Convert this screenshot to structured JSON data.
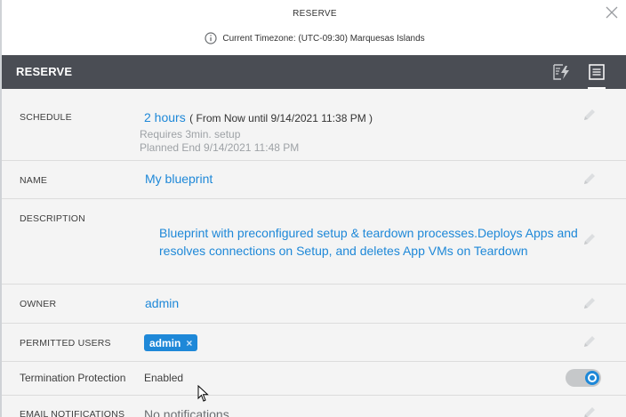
{
  "dialog": {
    "title": "RESERVE",
    "timezone_text": "Current Timezone: (UTC-09:30) Marquesas Islands"
  },
  "header_bar": {
    "title": "RESERVE",
    "icons": [
      "lightning-list-icon",
      "details-list-icon"
    ]
  },
  "schedule": {
    "label": "SCHEDULE",
    "duration": "2 hours",
    "range": "( From Now until 9/14/2021 11:38 PM )",
    "setup_note": "Requires 3min. setup",
    "planned_end": "Planned End 9/14/2021 11:48 PM"
  },
  "name": {
    "label": "NAME",
    "value": "My blueprint"
  },
  "description": {
    "label": "DESCRIPTION",
    "line1": "Blueprint with preconfigured setup & teardown processes.Deploys Apps and",
    "line2": "resolves connections on Setup, and deletes App VMs on Teardown"
  },
  "owner": {
    "label": "OWNER",
    "value": "admin"
  },
  "permitted_users": {
    "label": "PERMITTED USERS",
    "chip": "admin",
    "chip_remove": "×"
  },
  "termination_protection": {
    "label": "Termination Protection",
    "value": "Enabled",
    "toggle_on": true
  },
  "email_notifications": {
    "label": "EMAIL NOTIFICATIONS",
    "value": "No notifications"
  },
  "colors": {
    "accent": "#1e88d8",
    "header_bar": "#4a4d54",
    "content_bg": "#f4f4f4"
  }
}
